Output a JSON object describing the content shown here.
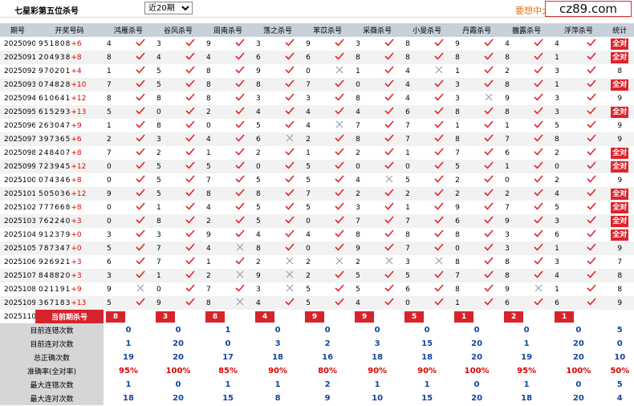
{
  "header": {
    "title": "七星彩第五位杀号",
    "period_select": "近20期",
    "promo": "要想中大",
    "logo": "cz89.com"
  },
  "columns": [
    "期号",
    "开奖号码",
    "鸿雁杀号",
    "谷风杀号",
    "周南杀号",
    "荡之杀号",
    "苯苡杀号",
    "采薇杀号",
    "小旻杀号",
    "丹霞杀号",
    "雒露杀号",
    "浮萍杀号",
    "统计"
  ],
  "rows": [
    {
      "p": "2025090",
      "n": "951808",
      "s": "+6",
      "v": [
        4,
        3,
        9,
        3,
        9,
        3,
        8,
        9,
        4,
        4
      ],
      "r": "1111111111",
      "t": "全对"
    },
    {
      "p": "2025091",
      "n": "204938",
      "s": "+8",
      "v": [
        8,
        4,
        4,
        6,
        6,
        8,
        8,
        8,
        8,
        1
      ],
      "r": "1111111111",
      "t": "全对"
    },
    {
      "p": "2025092",
      "n": "970201",
      "s": "+4",
      "v": [
        1,
        5,
        8,
        9,
        0,
        1,
        4,
        1,
        2,
        3
      ],
      "r": "1111010111",
      "t": "8"
    },
    {
      "p": "2025093",
      "n": "074828",
      "s": "+10",
      "v": [
        7,
        5,
        8,
        8,
        7,
        0,
        4,
        3,
        8,
        1
      ],
      "r": "1111111111",
      "t": "全对"
    },
    {
      "p": "2025094",
      "n": "610641",
      "s": "+12",
      "v": [
        8,
        8,
        8,
        3,
        3,
        8,
        4,
        3,
        9,
        3
      ],
      "r": "1111111011",
      "t": "9"
    },
    {
      "p": "2025095",
      "n": "615293",
      "s": "+13",
      "v": [
        5,
        0,
        2,
        4,
        4,
        4,
        6,
        8,
        8,
        3
      ],
      "r": "1111111111",
      "t": "全对"
    },
    {
      "p": "2025096",
      "n": "263047",
      "s": "+9",
      "v": [
        1,
        8,
        0,
        5,
        4,
        7,
        7,
        1,
        1,
        5
      ],
      "r": "1111011111",
      "t": "9"
    },
    {
      "p": "2025097",
      "n": "397365",
      "s": "+6",
      "v": [
        2,
        3,
        4,
        6,
        2,
        8,
        7,
        8,
        7,
        8
      ],
      "r": "1110111111",
      "t": "9"
    },
    {
      "p": "2025098",
      "n": "248407",
      "s": "+8",
      "v": [
        7,
        2,
        1,
        2,
        1,
        2,
        1,
        7,
        6,
        2
      ],
      "r": "1111111111",
      "t": "全对"
    },
    {
      "p": "2025099",
      "n": "723945",
      "s": "+12",
      "v": [
        0,
        5,
        5,
        0,
        5,
        0,
        0,
        5,
        1,
        0
      ],
      "r": "1111111111",
      "t": "全对"
    },
    {
      "p": "2025100",
      "n": "074346",
      "s": "+8",
      "v": [
        0,
        5,
        7,
        5,
        5,
        4,
        5,
        2,
        0,
        2
      ],
      "r": "1111101111",
      "t": "9"
    },
    {
      "p": "2025101",
      "n": "505036",
      "s": "+12",
      "v": [
        9,
        5,
        8,
        8,
        7,
        2,
        2,
        2,
        2,
        4
      ],
      "r": "1111111111",
      "t": "全对"
    },
    {
      "p": "2025102",
      "n": "777668",
      "s": "+8",
      "v": [
        0,
        1,
        4,
        5,
        5,
        3,
        1,
        9,
        7,
        5
      ],
      "r": "1111111111",
      "t": "全对"
    },
    {
      "p": "2025103",
      "n": "762240",
      "s": "+3",
      "v": [
        0,
        8,
        2,
        5,
        0,
        7,
        7,
        6,
        9,
        3
      ],
      "r": "1111111111",
      "t": "全对"
    },
    {
      "p": "2025104",
      "n": "912379",
      "s": "+0",
      "v": [
        3,
        3,
        9,
        4,
        4,
        8,
        8,
        8,
        3,
        6
      ],
      "r": "1111111111",
      "t": "全对"
    },
    {
      "p": "2025105",
      "n": "787347",
      "s": "+0",
      "v": [
        5,
        7,
        4,
        8,
        0,
        9,
        7,
        0,
        3,
        1
      ],
      "r": "1101111111",
      "t": "9"
    },
    {
      "p": "2025106",
      "n": "926921",
      "s": "+3",
      "v": [
        6,
        7,
        1,
        2,
        2,
        2,
        3,
        8,
        8,
        3
      ],
      "r": "1110000111",
      "t": "7"
    },
    {
      "p": "2025107",
      "n": "848820",
      "s": "+3",
      "v": [
        3,
        1,
        2,
        9,
        2,
        5,
        5,
        7,
        8,
        4
      ],
      "r": "1100111111",
      "t": "8"
    },
    {
      "p": "2025108",
      "n": "021191",
      "s": "+9",
      "v": [
        9,
        0,
        7,
        3,
        5,
        5,
        6,
        8,
        9,
        1
      ],
      "r": "0110111101",
      "t": "8"
    },
    {
      "p": "2025109",
      "n": "367183",
      "s": "+13",
      "v": [
        5,
        9,
        8,
        4,
        5,
        4,
        0,
        1,
        6,
        6
      ],
      "r": "1101111111",
      "t": "9"
    }
  ],
  "current": {
    "p": "2025110",
    "label": "当前期杀号",
    "v": [
      8,
      3,
      8,
      4,
      9,
      9,
      5,
      1,
      2,
      1
    ]
  },
  "stats": [
    {
      "label": "目前连错次数",
      "v": [
        "0",
        "0",
        "1",
        "0",
        "0",
        "0",
        "0",
        "0",
        "0",
        "0",
        "5"
      ],
      "c": "b"
    },
    {
      "label": "目前连对次数",
      "v": [
        "1",
        "20",
        "0",
        "3",
        "2",
        "3",
        "15",
        "20",
        "1",
        "20",
        "0"
      ],
      "c": "b"
    },
    {
      "label": "总正确次数",
      "v": [
        "19",
        "20",
        "17",
        "18",
        "16",
        "18",
        "18",
        "20",
        "19",
        "20",
        "10"
      ],
      "c": "b"
    },
    {
      "label": "准确率(全对率)",
      "v": [
        "95%",
        "100%",
        "85%",
        "90%",
        "80%",
        "90%",
        "90%",
        "100%",
        "95%",
        "100%",
        "50%"
      ],
      "c": "r"
    },
    {
      "label": "最大连错次数",
      "v": [
        "1",
        "0",
        "1",
        "1",
        "2",
        "1",
        "1",
        "0",
        "1",
        "0",
        "5"
      ],
      "c": "b"
    },
    {
      "label": "最大连对次数",
      "v": [
        "18",
        "20",
        "15",
        "8",
        "9",
        "10",
        "15",
        "20",
        "18",
        "20",
        "4"
      ],
      "c": "b"
    }
  ],
  "colors": {
    "header_bg": "#c8d1da",
    "check": "#e0242b",
    "cross": "#9aa0aa",
    "badge": "#d7232b",
    "stat_blue": "#1346a0",
    "stat_red": "#d00000"
  }
}
